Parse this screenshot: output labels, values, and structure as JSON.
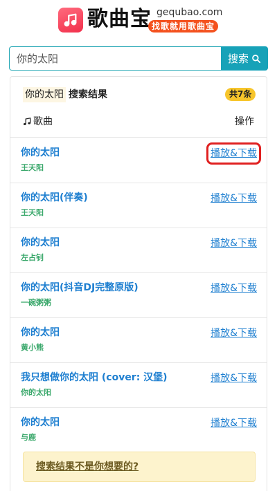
{
  "header": {
    "site_name": "歌曲宝",
    "domain": "gequbao.com",
    "slogan": "找歌就用歌曲宝",
    "logo_icon": "music-note-icon",
    "brand_color": "#f2304c",
    "slogan_color": "#f4511e"
  },
  "search": {
    "value": "你的太阳",
    "button_label": "搜索",
    "button_icon": "search-icon",
    "accent_color": "#17a2b8"
  },
  "results": {
    "query": "你的太阳",
    "label": "搜索结果",
    "count_badge": "共7条",
    "col_song": "歌曲",
    "col_action": "操作",
    "rows": [
      {
        "title": "你的太阳",
        "artist": "王天阳",
        "action": "播放&下载"
      },
      {
        "title": "你的太阳(伴奏)",
        "artist": "王天阳",
        "action": "播放&下载"
      },
      {
        "title": "你的太阳",
        "artist": "左占钊",
        "action": "播放&下载"
      },
      {
        "title": "你的太阳(抖音DJ完整原版)",
        "artist": "一碗粥粥",
        "action": "播放&下载"
      },
      {
        "title": "你的太阳",
        "artist": "黄小熊",
        "action": "播放&下载"
      },
      {
        "title": "我只想做你的太阳 (cover: 汉堡)",
        "artist": "你的太阳",
        "action": "播放&下载"
      },
      {
        "title": "你的太阳",
        "artist": "与鹿",
        "action": "播放&下载"
      }
    ]
  },
  "notice": {
    "link": "搜索结果不是你想要的?"
  }
}
